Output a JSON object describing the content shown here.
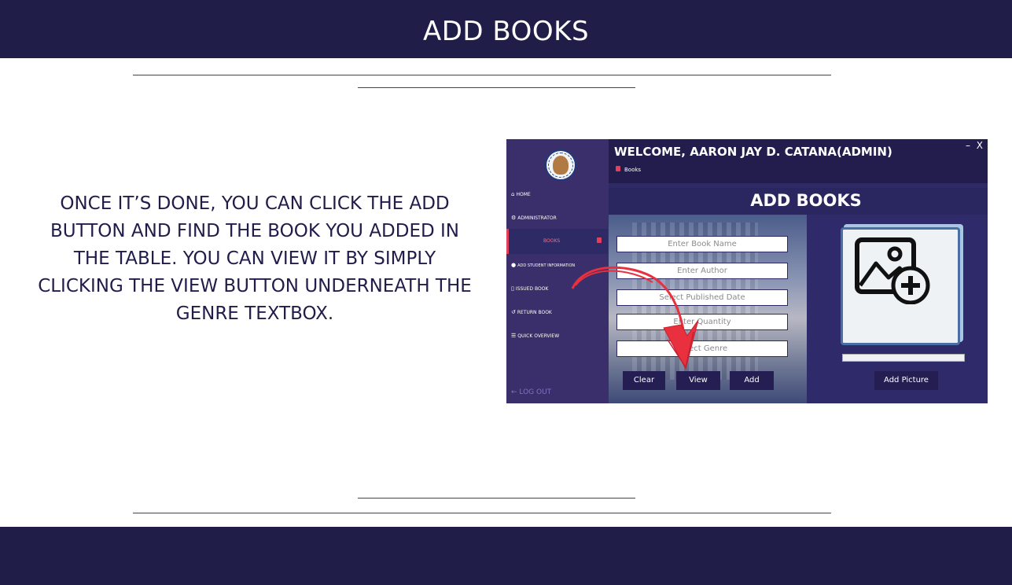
{
  "slide": {
    "title": "ADD BOOKS",
    "instructions": "ONCE IT’S DONE, YOU CAN CLICK THE ADD BUTTON AND FIND THE BOOK YOU ADDED IN THE TABLE. YOU CAN VIEW IT BY SIMPLY CLICKING THE VIEW BUTTON UNDERNEATH THE GENRE TEXTBOX."
  },
  "app": {
    "welcome": "WELCOME, AARON JAY D. CATANA(ADMIN)",
    "breadcrumb": "Books",
    "window_controls": "– X",
    "page_title": "ADD BOOKS",
    "sidebar": {
      "items": [
        {
          "icon": "home-icon",
          "glyph": "🏠︎",
          "label": "HOME"
        },
        {
          "icon": "gears-icon",
          "glyph": "⚙",
          "label": "ADMINISTRATOR"
        },
        {
          "icon": "book-icon",
          "glyph": "",
          "label": "BOOKS"
        },
        {
          "icon": "info-icon",
          "glyph": "❶",
          "label": "ADD STUDENT INFORMATION"
        },
        {
          "icon": "bookmark-icon",
          "glyph": "▯",
          "label": "ISSUED BOOK"
        },
        {
          "icon": "undo-icon",
          "glyph": "↺",
          "label": "RETURN BOOK"
        },
        {
          "icon": "list-icon",
          "glyph": "☰",
          "label": "QUICK OVERVIEW"
        }
      ],
      "logout": "← LOG OUT"
    },
    "form": {
      "book_name_placeholder": "Enter Book Name",
      "author_placeholder": "Enter Author",
      "published_date_placeholder": "Select Published Date",
      "quantity_placeholder": "Enter Quantity",
      "genre_placeholder": "Select Genre",
      "clear_label": "Clear",
      "view_label": "View",
      "add_label": "Add"
    },
    "picture": {
      "add_picture_label": "Add Picture"
    }
  },
  "colors": {
    "header_bg": "#201d48",
    "sidebar_bg": "#3a2f6a",
    "accent": "#e0405a",
    "arrow": "#e8303e"
  }
}
